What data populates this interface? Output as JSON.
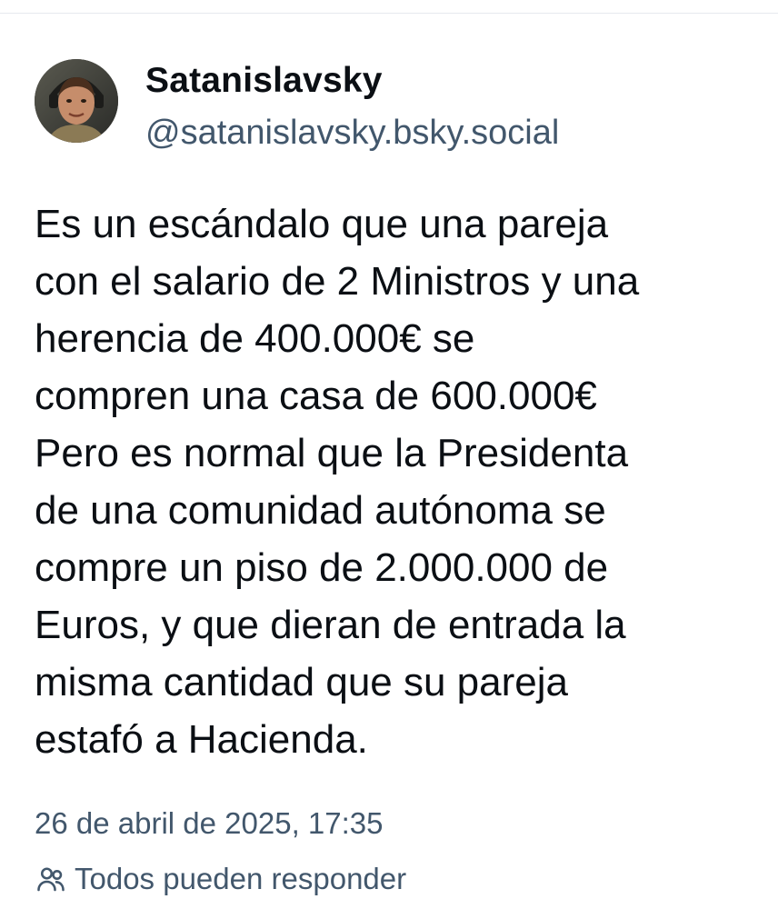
{
  "post": {
    "author": {
      "display_name": "Satanislavsky",
      "handle": "@satanislavsky.bsky.social"
    },
    "text_lines": [
      "Es un escándalo que una pareja",
      "con el salario de 2 Ministros y una",
      "herencia de 400.000€ se",
      "compren una casa de 600.000€",
      "Pero es normal que la Presidenta",
      "de una comunidad autónoma se",
      "compre un piso de 2.000.000 de",
      "Euros, y que dieran de entrada la",
      "misma cantidad que su pareja",
      "estafó a Hacienda."
    ],
    "timestamp": "26 de abril de 2025, 17:35",
    "reply_setting": {
      "icon": "people-icon",
      "label": "Todos pueden responder"
    }
  },
  "colors": {
    "text": "#0b0f14",
    "muted": "#42576c",
    "divider": "#e6e9ee",
    "background": "#ffffff"
  }
}
